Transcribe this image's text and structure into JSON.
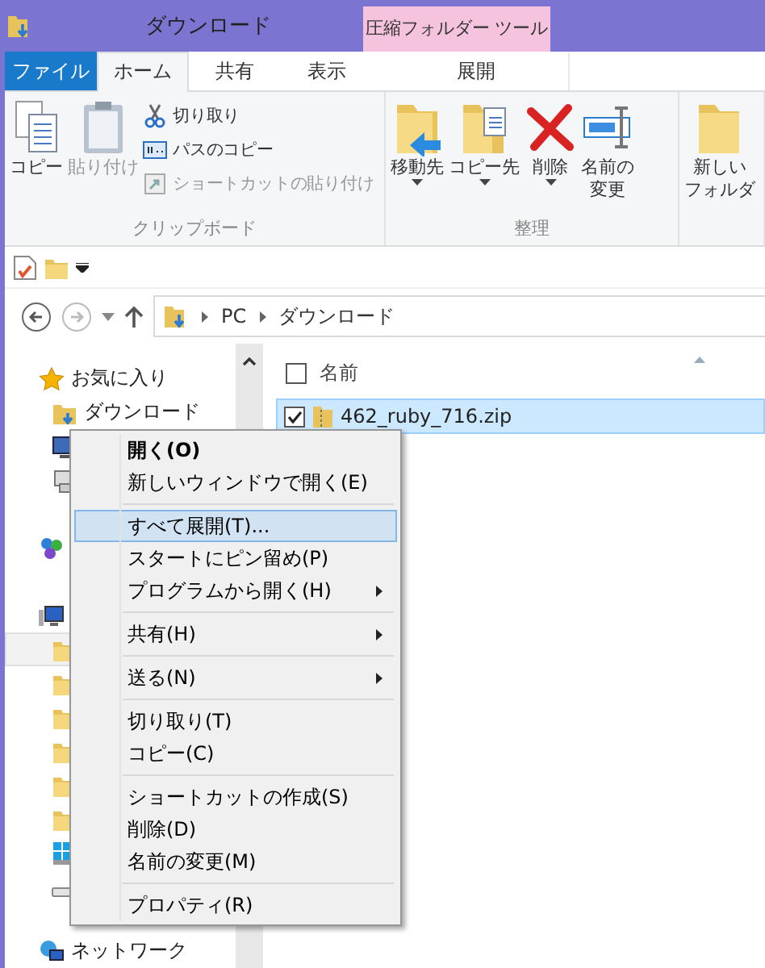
{
  "window": {
    "title": "ダウンロード",
    "context_tab_group": "圧縮フォルダー ツール"
  },
  "tabs": [
    {
      "label": "ファイル",
      "kind": "file",
      "selected": false
    },
    {
      "label": "ホーム",
      "kind": "tab",
      "selected": true
    },
    {
      "label": "共有",
      "kind": "tab",
      "selected": false
    },
    {
      "label": "表示",
      "kind": "tab",
      "selected": false
    },
    {
      "label": "展開",
      "kind": "context",
      "selected": false
    }
  ],
  "ribbon": {
    "groups": [
      {
        "label": "クリップボード",
        "large": [
          {
            "lines": [
              "コピー"
            ],
            "disabled": false,
            "dropdown": false
          },
          {
            "lines": [
              "貼り付け"
            ],
            "disabled": true,
            "dropdown": false
          }
        ],
        "small": [
          {
            "label": "切り取り",
            "disabled": false
          },
          {
            "label": "パスのコピー",
            "disabled": false
          },
          {
            "label": "ショートカットの貼り付け",
            "disabled": true
          }
        ]
      },
      {
        "label": "整理",
        "large": [
          {
            "lines": [
              "移動先"
            ],
            "disabled": false,
            "dropdown": true
          },
          {
            "lines": [
              "コピー先"
            ],
            "disabled": false,
            "dropdown": true
          },
          {
            "lines": [
              "削除"
            ],
            "disabled": false,
            "dropdown": true
          },
          {
            "lines": [
              "名前の",
              "変更"
            ],
            "disabled": false,
            "dropdown": false
          }
        ]
      },
      {
        "large": [
          {
            "lines": [
              "新しい",
              "フォルダ"
            ],
            "disabled": false,
            "dropdown": false
          }
        ]
      }
    ]
  },
  "address": {
    "path": [
      "PC",
      "ダウンロード"
    ]
  },
  "navigation_pane": [
    {
      "kind": "favorites",
      "label": "お気に入り",
      "selected": false
    },
    {
      "kind": "downloads",
      "label": "ダウンロード",
      "selected": false
    },
    {
      "kind": "desktop",
      "selected": false
    },
    {
      "kind": "recent",
      "selected": false
    },
    {
      "kind": "homegroup",
      "selected": false
    },
    {
      "kind": "computer",
      "selected": false
    },
    {
      "kind": "folder",
      "selected": true
    },
    {
      "kind": "folder",
      "selected": false
    },
    {
      "kind": "folder",
      "selected": false
    },
    {
      "kind": "folder",
      "selected": false
    },
    {
      "kind": "folder",
      "selected": false
    },
    {
      "kind": "folder",
      "selected": false
    },
    {
      "kind": "windrive",
      "selected": false
    },
    {
      "kind": "drive",
      "selected": false
    },
    {
      "kind": "network",
      "label": "ネットワーク",
      "selected": false
    }
  ],
  "file_list": {
    "column": "名前",
    "all_checked": false,
    "rows": [
      {
        "name": "462_ruby_716.zip",
        "checked": true,
        "selected": true
      }
    ]
  },
  "context_menu": [
    {
      "kind": "item",
      "label": "開く(O)",
      "default": true,
      "selected": false,
      "submenu": false
    },
    {
      "kind": "item",
      "label": "新しいウィンドウで開く(E)",
      "default": false,
      "selected": false,
      "submenu": false
    },
    {
      "kind": "separator"
    },
    {
      "kind": "item",
      "label": "すべて展開(T)...",
      "default": false,
      "selected": true,
      "submenu": false
    },
    {
      "kind": "item",
      "label": "スタートにピン留め(P)",
      "default": false,
      "selected": false,
      "submenu": false
    },
    {
      "kind": "item",
      "label": "プログラムから開く(H)",
      "default": false,
      "selected": false,
      "submenu": true
    },
    {
      "kind": "separator"
    },
    {
      "kind": "item",
      "label": "共有(H)",
      "default": false,
      "selected": false,
      "submenu": true
    },
    {
      "kind": "separator"
    },
    {
      "kind": "item",
      "label": "送る(N)",
      "default": false,
      "selected": false,
      "submenu": true
    },
    {
      "kind": "separator"
    },
    {
      "kind": "item",
      "label": "切り取り(T)",
      "default": false,
      "selected": false,
      "submenu": false
    },
    {
      "kind": "item",
      "label": "コピー(C)",
      "default": false,
      "selected": false,
      "submenu": false
    },
    {
      "kind": "separator"
    },
    {
      "kind": "item",
      "label": "ショートカットの作成(S)",
      "default": false,
      "selected": false,
      "submenu": false
    },
    {
      "kind": "item",
      "label": "削除(D)",
      "default": false,
      "selected": false,
      "submenu": false
    },
    {
      "kind": "item",
      "label": "名前の変更(M)",
      "default": false,
      "selected": false,
      "submenu": false
    },
    {
      "kind": "separator"
    },
    {
      "kind": "item",
      "label": "プロパティ(R)",
      "default": false,
      "selected": false,
      "submenu": false
    }
  ]
}
